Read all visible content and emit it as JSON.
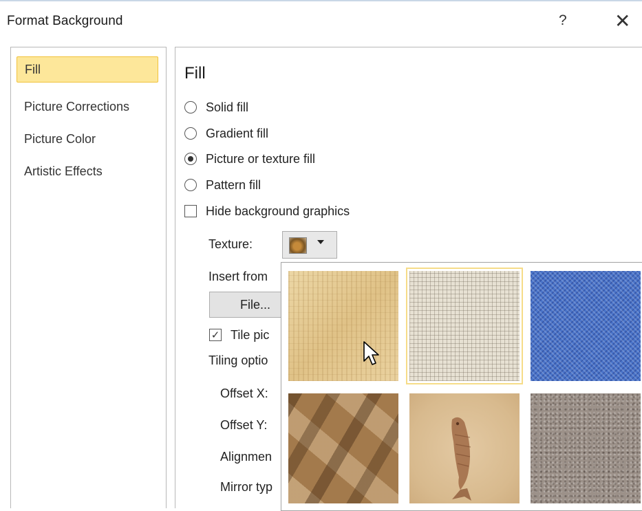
{
  "window": {
    "title": "Format Background",
    "help_glyph": "?",
    "close_glyph": "✕"
  },
  "sidebar": {
    "items": [
      {
        "label": "Fill",
        "selected": true
      },
      {
        "label": "Picture Corrections",
        "selected": false
      },
      {
        "label": "Picture Color",
        "selected": false
      },
      {
        "label": "Artistic Effects",
        "selected": false
      }
    ]
  },
  "fill": {
    "section_title": "Fill",
    "options": [
      {
        "label": "Solid fill",
        "selected": false
      },
      {
        "label": "Gradient fill",
        "selected": false
      },
      {
        "label": "Picture or texture fill",
        "selected": true
      },
      {
        "label": "Pattern fill",
        "selected": false
      }
    ],
    "hide_background_graphics": {
      "label": "Hide background graphics",
      "checked": false
    },
    "texture_label": "Texture:",
    "insert_from_label": "Insert from",
    "file_button_label": "File...",
    "tile_checkbox": {
      "label": "Tile pic",
      "checked": true
    },
    "tiling_options_label": "Tiling optio",
    "offset_x_label": "Offset X:",
    "offset_y_label": "Offset Y:",
    "alignment_label": "Alignmen",
    "mirror_type_label": "Mirror typ"
  },
  "texture_gallery": {
    "tiles": [
      {
        "name": "papyrus",
        "highlighted": false
      },
      {
        "name": "canvas",
        "highlighted": true
      },
      {
        "name": "denim",
        "highlighted": false
      },
      {
        "name": "paper-bag",
        "highlighted": false
      },
      {
        "name": "fish-fossil",
        "highlighted": false
      },
      {
        "name": "granite",
        "highlighted": false
      }
    ]
  },
  "colors": {
    "selected_nav_bg": "#fde79a",
    "selected_nav_border": "#f1c23a",
    "highlight_tile_border": "#f6dc88"
  }
}
